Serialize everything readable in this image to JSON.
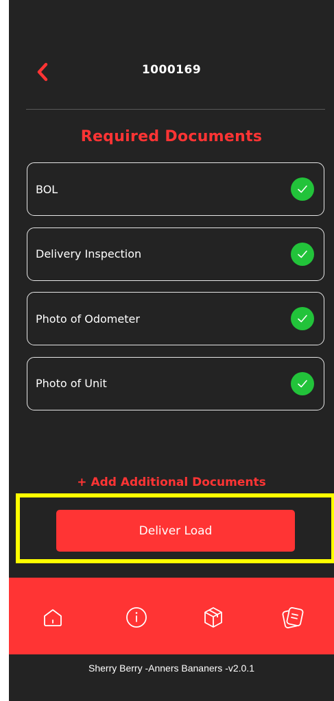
{
  "header": {
    "title": "1000169",
    "back_icon": "chevron-left-icon"
  },
  "section_title": "Required Documents",
  "documents": [
    {
      "label": "BOL",
      "status_icon": "check-circle-icon"
    },
    {
      "label": "Delivery Inspection",
      "status_icon": "check-circle-icon"
    },
    {
      "label": "Photo of Odometer",
      "status_icon": "check-circle-icon"
    },
    {
      "label": "Photo of Unit",
      "status_icon": "check-circle-icon"
    }
  ],
  "add_documents_label": "+ Add Additional Documents",
  "deliver_button_label": "Deliver Load",
  "tabs": [
    {
      "icon": "home-icon"
    },
    {
      "icon": "info-icon"
    },
    {
      "icon": "package-icon"
    },
    {
      "icon": "documents-icon"
    }
  ],
  "footer": "Sherry Berry  -Anners Bananers  -v2.0.1",
  "colors": {
    "accent": "#ff3434",
    "background": "#232323",
    "success": "#22c33a",
    "highlight": "#ffff00"
  }
}
